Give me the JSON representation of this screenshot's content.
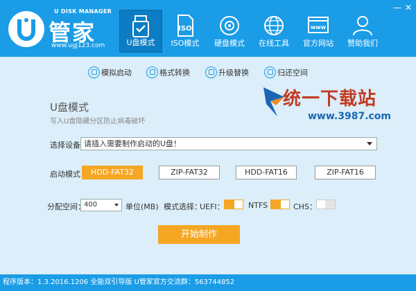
{
  "logo": {
    "subtitle": "U DISK MANAGER",
    "title": "U管家",
    "title_short": "管家",
    "url": "www.ugj123.com"
  },
  "nav": [
    {
      "label": "U盘模式",
      "icon": "usb-drive-icon",
      "active": true
    },
    {
      "label": "ISO模式",
      "icon": "iso-file-icon",
      "active": false
    },
    {
      "label": "硬盘模式",
      "icon": "hard-disk-icon",
      "active": false
    },
    {
      "label": "在线工具",
      "icon": "globe-icon",
      "active": false
    },
    {
      "label": "官方网站",
      "icon": "website-icon",
      "active": false
    },
    {
      "label": "赞助我们",
      "icon": "user-icon",
      "active": false
    }
  ],
  "window": {
    "minimize": "—",
    "close": "✕"
  },
  "tools": [
    {
      "label": "模拟启动",
      "icon": "simulate-icon"
    },
    {
      "label": "格式转换",
      "icon": "convert-icon"
    },
    {
      "label": "升级替换",
      "icon": "upgrade-icon"
    },
    {
      "label": "归还空间",
      "icon": "restore-icon"
    }
  ],
  "section": {
    "title": "U盘模式",
    "subtitle": "写入U盘隐藏分区防止病毒破坏"
  },
  "watermark": {
    "text": "统一下载站",
    "url": "www.3987.com"
  },
  "device": {
    "label": "选择设备：",
    "value": "请插入需要制作启动的U盘！"
  },
  "boot": {
    "label": "启动模式：",
    "modes": [
      "HDD-FAT32",
      "ZIP-FAT32",
      "HDD-FAT16",
      "ZIP-FAT16"
    ],
    "selected": "HDD-FAT32"
  },
  "alloc": {
    "label": "分配空间：",
    "value": "400",
    "unit": "单位(MB)"
  },
  "mode_select": {
    "label": "模式选择：",
    "options": [
      {
        "label": "UEFI：",
        "on": true
      },
      {
        "label": "NTFS",
        "on": true
      },
      {
        "label": "CHS：",
        "on": false
      }
    ]
  },
  "start_button": "开始制作",
  "status": "程序版本：1.3.2016.1206 全能双引导版 U管家官方交流群：563744852",
  "colors": {
    "primary": "#1b9ce6",
    "accent": "#f5a623",
    "background": "#dbeef9"
  }
}
